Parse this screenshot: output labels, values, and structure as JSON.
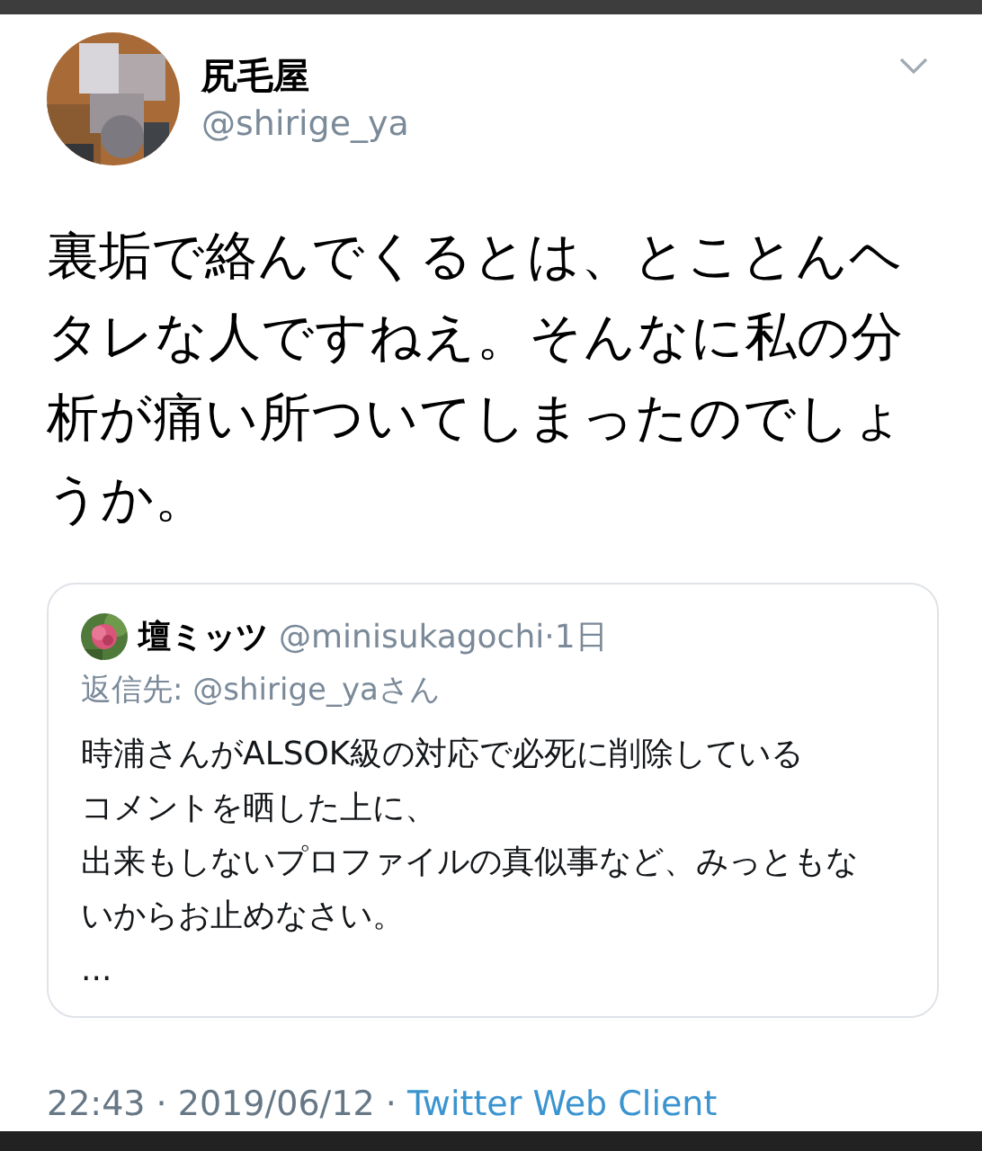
{
  "author": {
    "name": "尻毛屋",
    "handle": "@shirige_ya"
  },
  "tweet_text": "裏垢で絡んでくるとは、とことんヘタレな人ですねえ。そんなに私の分析が痛い所ついてしまったのでしょうか。",
  "quoted_tweet": {
    "name": "壇ミッツ",
    "handle": "@minisukagochi",
    "time": "·1日",
    "reply_to": "返信先: @shirige_yaさん",
    "lines": [
      "時浦さんがALSOK級の対応で必死に削除している",
      "コメントを晒した上に、",
      "出来もしないプロファイルの真似事など、みっともないからお止めなさい。",
      "..."
    ]
  },
  "timestamp": "22:43 · 2019/06/12 ·",
  "source": "Twitter Web Client"
}
